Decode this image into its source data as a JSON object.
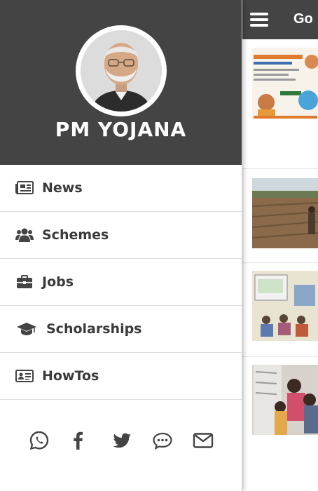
{
  "app": {
    "header_title": "Go"
  },
  "drawer": {
    "brand": "PM YOJANA",
    "menu": [
      {
        "label": "News",
        "icon": "newspaper-icon"
      },
      {
        "label": "Schemes",
        "icon": "users-icon"
      },
      {
        "label": "Jobs",
        "icon": "briefcase-icon"
      },
      {
        "label": "Scholarships",
        "icon": "graduation-cap-icon"
      },
      {
        "label": "HowTos",
        "icon": "id-card-icon"
      }
    ],
    "social": [
      "whatsapp-icon",
      "facebook-icon",
      "twitter-icon",
      "comment-icon",
      "envelope-icon"
    ]
  },
  "colors": {
    "header_bg": "#444444",
    "menu_text": "#3a3a3a",
    "icon_color": "#444444"
  }
}
